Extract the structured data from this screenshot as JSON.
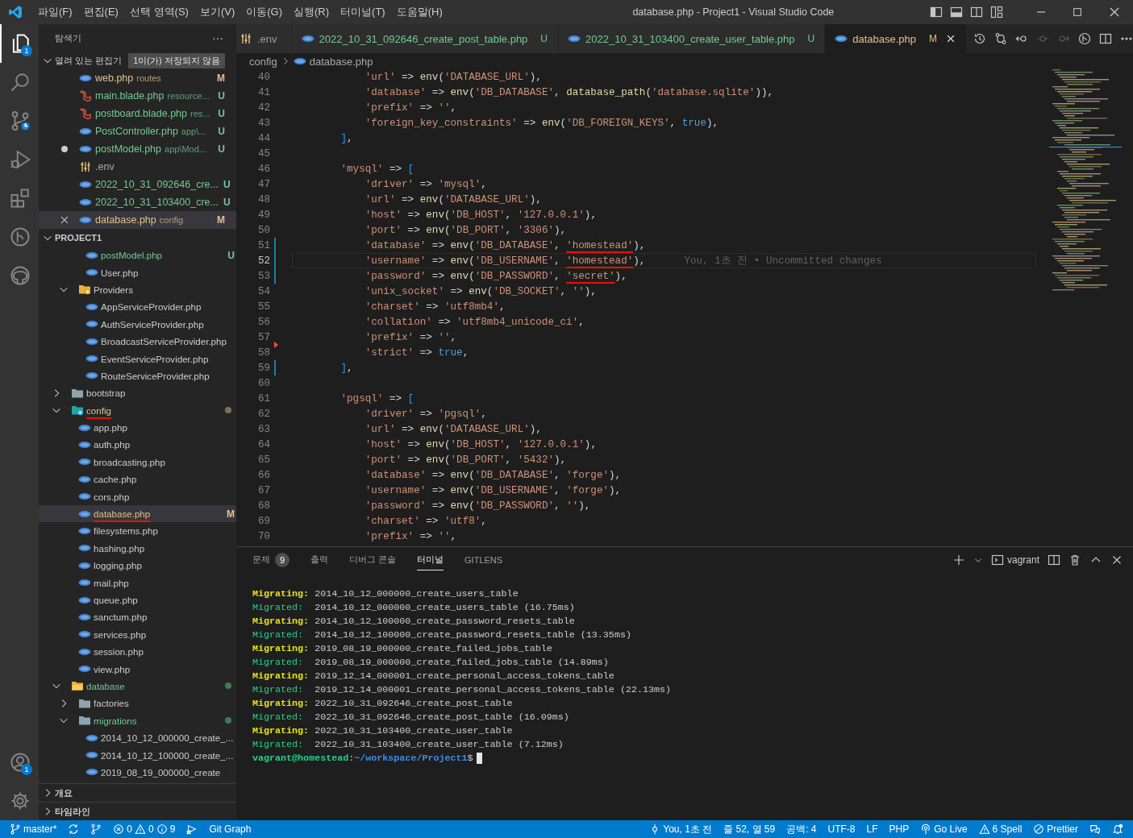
{
  "title_bar": {
    "menus": [
      "파일(F)",
      "편집(E)",
      "선택 영역(S)",
      "보기(V)",
      "이동(G)",
      "실행(R)",
      "터미널(T)",
      "도움말(H)"
    ],
    "title": "database.php - Project1 - Visual Studio Code"
  },
  "activity_bar": {
    "explorer_badge": "1",
    "accounts_badge": "1"
  },
  "sidebar": {
    "title": "탐색기",
    "more": "···",
    "open_editors": {
      "label": "열려 있는 편집기",
      "badge": "1이(가) 저장되지 않음",
      "items": [
        {
          "name": "web.php",
          "detail": "routes",
          "kind": "php",
          "color": "#e2c08d",
          "badge": "M",
          "dirty": false,
          "selected": false
        },
        {
          "name": "main.blade.php",
          "detail": "resource...",
          "kind": "blade",
          "color": "#73c991",
          "badge": "U",
          "dirty": false,
          "selected": false
        },
        {
          "name": "postboard.blade.php",
          "detail": "res...",
          "kind": "blade",
          "color": "#73c991",
          "badge": "U",
          "dirty": false,
          "selected": false
        },
        {
          "name": "PostController.php",
          "detail": "app\\...",
          "kind": "php",
          "color": "#73c991",
          "badge": "U",
          "dirty": false,
          "selected": false
        },
        {
          "name": "postModel.php",
          "detail": "app\\Mod...",
          "kind": "php",
          "color": "#73c991",
          "badge": "U",
          "dirty": true,
          "selected": false
        },
        {
          "name": ".env",
          "kind": "env",
          "color": "#a8a8a8",
          "dirty": false,
          "selected": false
        },
        {
          "name": "2022_10_31_092646_cre...",
          "kind": "php",
          "color": "#73c991",
          "badge": "U",
          "dirty": false,
          "selected": false
        },
        {
          "name": "2022_10_31_103400_cre...",
          "kind": "php",
          "color": "#73c991",
          "badge": "U",
          "dirty": false,
          "selected": false
        },
        {
          "name": "database.php",
          "detail": "config",
          "kind": "php",
          "color": "#e2c08d",
          "badge": "M",
          "dirty": false,
          "selected": true
        }
      ]
    },
    "project": {
      "label": "PROJECT1",
      "tree": [
        {
          "kind": "hidden",
          "children": [
            {
              "kind": "hidden",
              "children": [
                {
                  "name": "postModel.php",
                  "kind": "php",
                  "color": "#73c991",
                  "badge": "U",
                  "selected": false,
                  "underlined": false
                },
                {
                  "name": "User.php",
                  "kind": "php",
                  "selected": false,
                  "underlined": false
                }
              ]
            },
            {
              "name": "Providers",
              "kind": "folder-gear",
              "expanded": true,
              "selected": false,
              "underlined": false,
              "children": [
                {
                  "name": "AppServiceProvider.php",
                  "kind": "php",
                  "selected": false,
                  "underlined": false
                },
                {
                  "name": "AuthServiceProvider.php",
                  "kind": "php",
                  "selected": false,
                  "underlined": false
                },
                {
                  "name": "BroadcastServiceProvider.php",
                  "kind": "php",
                  "selected": false,
                  "underlined": false
                },
                {
                  "name": "EventServiceProvider.php",
                  "kind": "php",
                  "selected": false,
                  "underlined": false
                },
                {
                  "name": "RouteServiceProvider.php",
                  "kind": "php",
                  "selected": false,
                  "underlined": false
                }
              ]
            }
          ]
        },
        {
          "name": "bootstrap",
          "kind": "folder",
          "expanded": false,
          "selected": false,
          "underlined": false
        },
        {
          "name": "config",
          "kind": "folder-config",
          "expanded": true,
          "color": "#e2c08d",
          "dot": {
            "color": "#7d6e5a"
          },
          "selected": false,
          "underlined": true,
          "children": [
            {
              "name": "app.php",
              "kind": "php",
              "selected": false,
              "underlined": false
            },
            {
              "name": "auth.php",
              "kind": "php",
              "selected": false,
              "underlined": false
            },
            {
              "name": "broadcasting.php",
              "kind": "php",
              "selected": false,
              "underlined": false
            },
            {
              "name": "cache.php",
              "kind": "php",
              "selected": false,
              "underlined": false
            },
            {
              "name": "cors.php",
              "kind": "php",
              "selected": false,
              "underlined": false
            },
            {
              "name": "database.php",
              "kind": "php",
              "color": "#e2c08d",
              "badge": "M",
              "selected": true,
              "underlined": true
            },
            {
              "name": "filesystems.php",
              "kind": "php",
              "selected": false,
              "underlined": false
            },
            {
              "name": "hashing.php",
              "kind": "php",
              "selected": false,
              "underlined": false
            },
            {
              "name": "logging.php",
              "kind": "php",
              "selected": false,
              "underlined": false
            },
            {
              "name": "mail.php",
              "kind": "php",
              "selected": false,
              "underlined": false
            },
            {
              "name": "queue.php",
              "kind": "php",
              "selected": false,
              "underlined": false
            },
            {
              "name": "sanctum.php",
              "kind": "php",
              "selected": false,
              "underlined": false
            },
            {
              "name": "services.php",
              "kind": "php",
              "selected": false,
              "underlined": false
            },
            {
              "name": "session.php",
              "kind": "php",
              "selected": false,
              "underlined": false
            },
            {
              "name": "view.php",
              "kind": "php",
              "selected": false,
              "underlined": false
            }
          ]
        },
        {
          "name": "database",
          "kind": "folder-db",
          "expanded": true,
          "color": "#73c991",
          "dot": {
            "color": "#3f7a53"
          },
          "selected": false,
          "underlined": false,
          "children": [
            {
              "name": "factories",
              "kind": "folder",
              "expanded": false,
              "selected": false,
              "underlined": false
            },
            {
              "name": "migrations",
              "kind": "folder",
              "expanded": true,
              "color": "#73c991",
              "dot": {
                "color": "#3f7a53"
              },
              "selected": false,
              "underlined": false,
              "children": [
                {
                  "name": "2014_10_12_000000_create_...",
                  "kind": "php",
                  "selected": false,
                  "underlined": false
                },
                {
                  "name": "2014_10_12_100000_create_...",
                  "kind": "php",
                  "selected": false,
                  "underlined": false
                },
                {
                  "name": "2019_08_19_000000_create",
                  "kind": "php",
                  "selected": false,
                  "underlined": false
                }
              ]
            }
          ]
        }
      ]
    },
    "sections": [
      "개요",
      "타임라인"
    ]
  },
  "tabs": [
    {
      "name": ".env",
      "kind": "env",
      "color": "#9d9d9d",
      "selected": false
    },
    {
      "name": "2022_10_31_092646_create_post_table.php",
      "kind": "php",
      "color": "#73c991",
      "badge": "U",
      "selected": false
    },
    {
      "name": "2022_10_31_103400_create_user_table.php",
      "kind": "php",
      "color": "#73c991",
      "badge": "U",
      "selected": false
    },
    {
      "name": "database.php",
      "kind": "php",
      "color": "#e2c08d",
      "badge": "M",
      "selected": true
    }
  ],
  "breadcrumb": [
    "config",
    "database.php"
  ],
  "code": [
    {
      "number": "40",
      "current": false,
      "modified": false,
      "deleted": false,
      "tokens": [
        {
          "kind": "s",
          "text": "            'url'"
        },
        {
          "kind": "p",
          "text": " => "
        },
        {
          "kind": "f",
          "text": "env"
        },
        {
          "kind": "p",
          "text": "("
        },
        {
          "kind": "s",
          "text": "'DATABASE_URL'"
        },
        {
          "kind": "p",
          "text": "),"
        }
      ]
    },
    {
      "number": "41",
      "current": false,
      "modified": false,
      "deleted": false,
      "tokens": [
        {
          "kind": "s",
          "text": "            'database'"
        },
        {
          "kind": "p",
          "text": " => "
        },
        {
          "kind": "f",
          "text": "env"
        },
        {
          "kind": "p",
          "text": "("
        },
        {
          "kind": "s",
          "text": "'DB_DATABASE'"
        },
        {
          "kind": "p",
          "text": ", "
        },
        {
          "kind": "f",
          "text": "database_path"
        },
        {
          "kind": "p",
          "text": "("
        },
        {
          "kind": "s",
          "text": "'database.sqlite'"
        },
        {
          "kind": "p",
          "text": ")),"
        }
      ]
    },
    {
      "number": "42",
      "current": false,
      "modified": false,
      "deleted": false,
      "tokens": [
        {
          "kind": "s",
          "text": "            'prefix'"
        },
        {
          "kind": "p",
          "text": " => "
        },
        {
          "kind": "s",
          "text": "''"
        },
        {
          "kind": "p",
          "text": ","
        }
      ]
    },
    {
      "number": "43",
      "current": false,
      "modified": false,
      "deleted": false,
      "tokens": [
        {
          "kind": "s",
          "text": "            'foreign_key_constraints'"
        },
        {
          "kind": "p",
          "text": " => "
        },
        {
          "kind": "f",
          "text": "env"
        },
        {
          "kind": "p",
          "text": "("
        },
        {
          "kind": "s",
          "text": "'DB_FOREIGN_KEYS'"
        },
        {
          "kind": "p",
          "text": ", "
        },
        {
          "kind": "k",
          "text": "true"
        },
        {
          "kind": "p",
          "text": "),"
        }
      ]
    },
    {
      "number": "44",
      "current": false,
      "modified": false,
      "deleted": false,
      "tokens": [
        {
          "kind": "b",
          "text": "        ]"
        },
        {
          "kind": "p",
          "text": ","
        }
      ]
    },
    {
      "number": "45",
      "current": false,
      "modified": false,
      "deleted": false
    },
    {
      "number": "46",
      "current": false,
      "modified": false,
      "deleted": false,
      "tokens": [
        {
          "kind": "s",
          "text": "        'mysql'"
        },
        {
          "kind": "p",
          "text": " => "
        },
        {
          "kind": "b",
          "text": "["
        }
      ]
    },
    {
      "number": "47",
      "current": false,
      "modified": false,
      "deleted": false,
      "tokens": [
        {
          "kind": "s",
          "text": "            'driver'"
        },
        {
          "kind": "p",
          "text": " => "
        },
        {
          "kind": "s",
          "text": "'mysql'"
        },
        {
          "kind": "p",
          "text": ","
        }
      ]
    },
    {
      "number": "48",
      "current": false,
      "modified": false,
      "deleted": false,
      "tokens": [
        {
          "kind": "s",
          "text": "            'url'"
        },
        {
          "kind": "p",
          "text": " => "
        },
        {
          "kind": "f",
          "text": "env"
        },
        {
          "kind": "p",
          "text": "("
        },
        {
          "kind": "s",
          "text": "'DATABASE_URL'"
        },
        {
          "kind": "p",
          "text": "),"
        }
      ]
    },
    {
      "number": "49",
      "current": false,
      "modified": false,
      "deleted": false,
      "tokens": [
        {
          "kind": "s",
          "text": "            'host'"
        },
        {
          "kind": "p",
          "text": " => "
        },
        {
          "kind": "f",
          "text": "env"
        },
        {
          "kind": "p",
          "text": "("
        },
        {
          "kind": "s",
          "text": "'DB_HOST'"
        },
        {
          "kind": "p",
          "text": ", "
        },
        {
          "kind": "s",
          "text": "'127.0.0.1'"
        },
        {
          "kind": "p",
          "text": "),"
        }
      ]
    },
    {
      "number": "50",
      "current": false,
      "modified": false,
      "deleted": false,
      "tokens": [
        {
          "kind": "s",
          "text": "            'port'"
        },
        {
          "kind": "p",
          "text": " => "
        },
        {
          "kind": "f",
          "text": "env"
        },
        {
          "kind": "p",
          "text": "("
        },
        {
          "kind": "s",
          "text": "'DB_PORT'"
        },
        {
          "kind": "p",
          "text": ", "
        },
        {
          "kind": "s",
          "text": "'3306'"
        },
        {
          "kind": "p",
          "text": "),"
        }
      ]
    },
    {
      "number": "51",
      "current": false,
      "modified": true,
      "deleted": false,
      "tokens": [
        {
          "kind": "s",
          "text": "            'database'"
        },
        {
          "kind": "p",
          "text": " => "
        },
        {
          "kind": "f",
          "text": "env"
        },
        {
          "kind": "p",
          "text": "("
        },
        {
          "kind": "s",
          "text": "'DB_DATABASE'"
        },
        {
          "kind": "p",
          "text": ", "
        },
        {
          "kind": "su",
          "text": "'homestead'"
        },
        {
          "kind": "p",
          "text": "),"
        }
      ]
    },
    {
      "number": "52",
      "current": true,
      "modified": true,
      "deleted": false,
      "blame": "You, 1초 전 • Uncommitted changes",
      "tokens": [
        {
          "kind": "s",
          "text": "            'username'"
        },
        {
          "kind": "p",
          "text": " => "
        },
        {
          "kind": "f",
          "text": "env"
        },
        {
          "kind": "p",
          "text": "("
        },
        {
          "kind": "s",
          "text": "'DB_USERNAME'"
        },
        {
          "kind": "p",
          "text": ", "
        },
        {
          "kind": "su",
          "text": "'homestead'"
        },
        {
          "kind": "p",
          "text": "),"
        }
      ]
    },
    {
      "number": "53",
      "current": false,
      "modified": true,
      "deleted": false,
      "tokens": [
        {
          "kind": "s",
          "text": "            'password'"
        },
        {
          "kind": "p",
          "text": " => "
        },
        {
          "kind": "f",
          "text": "env"
        },
        {
          "kind": "p",
          "text": "("
        },
        {
          "kind": "s",
          "text": "'DB_PASSWORD'"
        },
        {
          "kind": "p",
          "text": ", "
        },
        {
          "kind": "su",
          "text": "'secret'"
        },
        {
          "kind": "p",
          "text": "),"
        }
      ]
    },
    {
      "number": "54",
      "current": false,
      "modified": false,
      "deleted": false,
      "tokens": [
        {
          "kind": "s",
          "text": "            'unix_socket'"
        },
        {
          "kind": "p",
          "text": " => "
        },
        {
          "kind": "f",
          "text": "env"
        },
        {
          "kind": "p",
          "text": "("
        },
        {
          "kind": "s",
          "text": "'DB_SOCKET'"
        },
        {
          "kind": "p",
          "text": ", "
        },
        {
          "kind": "s",
          "text": "''"
        },
        {
          "kind": "p",
          "text": "),"
        }
      ]
    },
    {
      "number": "55",
      "current": false,
      "modified": false,
      "deleted": false,
      "tokens": [
        {
          "kind": "s",
          "text": "            'charset'"
        },
        {
          "kind": "p",
          "text": " => "
        },
        {
          "kind": "s",
          "text": "'utf8mb4'"
        },
        {
          "kind": "p",
          "text": ","
        }
      ]
    },
    {
      "number": "56",
      "current": false,
      "modified": false,
      "deleted": false,
      "tokens": [
        {
          "kind": "s",
          "text": "            'collation'"
        },
        {
          "kind": "p",
          "text": " => "
        },
        {
          "kind": "s",
          "text": "'utf8mb4_unicode_ci'"
        },
        {
          "kind": "p",
          "text": ","
        }
      ]
    },
    {
      "number": "57",
      "current": false,
      "modified": false,
      "deleted": false,
      "tokens": [
        {
          "kind": "s",
          "text": "            'prefix'"
        },
        {
          "kind": "p",
          "text": " => "
        },
        {
          "kind": "s",
          "text": "''"
        },
        {
          "kind": "p",
          "text": ","
        }
      ]
    },
    {
      "number": "58",
      "current": false,
      "modified": false,
      "deleted": true,
      "tokens": [
        {
          "kind": "s",
          "text": "            'strict'"
        },
        {
          "kind": "p",
          "text": " => "
        },
        {
          "kind": "k",
          "text": "true"
        },
        {
          "kind": "p",
          "text": ","
        }
      ]
    },
    {
      "number": "59",
      "current": false,
      "modified": true,
      "deleted": false,
      "tokens": [
        {
          "kind": "b",
          "text": "        ]"
        },
        {
          "kind": "p",
          "text": ","
        }
      ]
    },
    {
      "number": "60",
      "current": false,
      "modified": false,
      "deleted": false
    },
    {
      "number": "61",
      "current": false,
      "modified": false,
      "deleted": false,
      "tokens": [
        {
          "kind": "s",
          "text": "        'pgsql'"
        },
        {
          "kind": "p",
          "text": " => "
        },
        {
          "kind": "b",
          "text": "["
        }
      ]
    },
    {
      "number": "62",
      "current": false,
      "modified": false,
      "deleted": false,
      "tokens": [
        {
          "kind": "s",
          "text": "            'driver'"
        },
        {
          "kind": "p",
          "text": " => "
        },
        {
          "kind": "s",
          "text": "'pgsql'"
        },
        {
          "kind": "p",
          "text": ","
        }
      ]
    },
    {
      "number": "63",
      "current": false,
      "modified": false,
      "deleted": false,
      "tokens": [
        {
          "kind": "s",
          "text": "            'url'"
        },
        {
          "kind": "p",
          "text": " => "
        },
        {
          "kind": "f",
          "text": "env"
        },
        {
          "kind": "p",
          "text": "("
        },
        {
          "kind": "s",
          "text": "'DATABASE_URL'"
        },
        {
          "kind": "p",
          "text": "),"
        }
      ]
    },
    {
      "number": "64",
      "current": false,
      "modified": false,
      "deleted": false,
      "tokens": [
        {
          "kind": "s",
          "text": "            'host'"
        },
        {
          "kind": "p",
          "text": " => "
        },
        {
          "kind": "f",
          "text": "env"
        },
        {
          "kind": "p",
          "text": "("
        },
        {
          "kind": "s",
          "text": "'DB_HOST'"
        },
        {
          "kind": "p",
          "text": ", "
        },
        {
          "kind": "s",
          "text": "'127.0.0.1'"
        },
        {
          "kind": "p",
          "text": "),"
        }
      ]
    },
    {
      "number": "65",
      "current": false,
      "modified": false,
      "deleted": false,
      "tokens": [
        {
          "kind": "s",
          "text": "            'port'"
        },
        {
          "kind": "p",
          "text": " => "
        },
        {
          "kind": "f",
          "text": "env"
        },
        {
          "kind": "p",
          "text": "("
        },
        {
          "kind": "s",
          "text": "'DB_PORT'"
        },
        {
          "kind": "p",
          "text": ", "
        },
        {
          "kind": "s",
          "text": "'5432'"
        },
        {
          "kind": "p",
          "text": "),"
        }
      ]
    },
    {
      "number": "66",
      "current": false,
      "modified": false,
      "deleted": false,
      "tokens": [
        {
          "kind": "s",
          "text": "            'database'"
        },
        {
          "kind": "p",
          "text": " => "
        },
        {
          "kind": "f",
          "text": "env"
        },
        {
          "kind": "p",
          "text": "("
        },
        {
          "kind": "s",
          "text": "'DB_DATABASE'"
        },
        {
          "kind": "p",
          "text": ", "
        },
        {
          "kind": "s",
          "text": "'forge'"
        },
        {
          "kind": "p",
          "text": "),"
        }
      ]
    },
    {
      "number": "67",
      "current": false,
      "modified": false,
      "deleted": false,
      "tokens": [
        {
          "kind": "s",
          "text": "            'username'"
        },
        {
          "kind": "p",
          "text": " => "
        },
        {
          "kind": "f",
          "text": "env"
        },
        {
          "kind": "p",
          "text": "("
        },
        {
          "kind": "s",
          "text": "'DB_USERNAME'"
        },
        {
          "kind": "p",
          "text": ", "
        },
        {
          "kind": "s",
          "text": "'forge'"
        },
        {
          "kind": "p",
          "text": "),"
        }
      ]
    },
    {
      "number": "68",
      "current": false,
      "modified": false,
      "deleted": false,
      "tokens": [
        {
          "kind": "s",
          "text": "            'password'"
        },
        {
          "kind": "p",
          "text": " => "
        },
        {
          "kind": "f",
          "text": "env"
        },
        {
          "kind": "p",
          "text": "("
        },
        {
          "kind": "s",
          "text": "'DB_PASSWORD'"
        },
        {
          "kind": "p",
          "text": ", "
        },
        {
          "kind": "s",
          "text": "''"
        },
        {
          "kind": "p",
          "text": "),"
        }
      ]
    },
    {
      "number": "69",
      "current": false,
      "modified": false,
      "deleted": false,
      "tokens": [
        {
          "kind": "s",
          "text": "            'charset'"
        },
        {
          "kind": "p",
          "text": " => "
        },
        {
          "kind": "s",
          "text": "'utf8'"
        },
        {
          "kind": "p",
          "text": ","
        }
      ]
    },
    {
      "number": "70",
      "current": false,
      "modified": false,
      "deleted": false,
      "tokens": [
        {
          "kind": "s",
          "text": "            'prefix'"
        },
        {
          "kind": "p",
          "text": " => "
        },
        {
          "kind": "s",
          "text": "''"
        },
        {
          "kind": "p",
          "text": ","
        }
      ]
    }
  ],
  "panel": {
    "tabs": [
      {
        "label": "문제",
        "badge": "9",
        "selected": false
      },
      {
        "label": "출력",
        "selected": false
      },
      {
        "label": "디버그 콘솔",
        "selected": false
      },
      {
        "label": "터미널",
        "selected": true
      },
      {
        "label": "GITLENS",
        "selected": false
      }
    ],
    "terminal_name": "vagrant",
    "terminal": [
      {
        "kind": "migrating",
        "label": "Migrating:",
        "text": "2014_10_12_000000_create_users_table"
      },
      {
        "kind": "migrated",
        "label": "Migrated:",
        "text": "2014_10_12_000000_create_users_table (16.75ms)"
      },
      {
        "kind": "migrating",
        "label": "Migrating:",
        "text": "2014_10_12_100000_create_password_resets_table"
      },
      {
        "kind": "migrated",
        "label": "Migrated:",
        "text": "2014_10_12_100000_create_password_resets_table (13.35ms)"
      },
      {
        "kind": "migrating",
        "label": "Migrating:",
        "text": "2019_08_19_000000_create_failed_jobs_table"
      },
      {
        "kind": "migrated",
        "label": "Migrated:",
        "text": "2019_08_19_000000_create_failed_jobs_table (14.89ms)"
      },
      {
        "kind": "migrating",
        "label": "Migrating:",
        "text": "2019_12_14_000001_create_personal_access_tokens_table"
      },
      {
        "kind": "migrated",
        "label": "Migrated:",
        "text": "2019_12_14_000001_create_personal_access_tokens_table (22.13ms)"
      },
      {
        "kind": "migrating",
        "label": "Migrating:",
        "text": "2022_10_31_092646_create_post_table"
      },
      {
        "kind": "migrated",
        "label": "Migrated:",
        "text": "2022_10_31_092646_create_post_table (16.09ms)"
      },
      {
        "kind": "migrating",
        "label": "Migrating:",
        "text": "2022_10_31_103400_create_user_table"
      },
      {
        "kind": "migrated",
        "label": "Migrated:",
        "text": "2022_10_31_103400_create_user_table (7.12ms)"
      },
      {
        "kind": "prompt",
        "user": "vagrant@homestead",
        "sep": ":",
        "path": "~/workspace/Project1",
        "symbol": "$"
      }
    ]
  },
  "status_bar": {
    "branch": "master*",
    "errors": "0",
    "warnings": "0",
    "infos": "9",
    "git_graph": "Git Graph",
    "blame": "You, 1초 전",
    "position": "줄 52, 열 59",
    "indent": "공백: 4",
    "encoding": "UTF-8",
    "eol": "LF",
    "language": "PHP",
    "go_live": "Go Live",
    "spell": "6 Spell",
    "prettier": "Prettier"
  }
}
